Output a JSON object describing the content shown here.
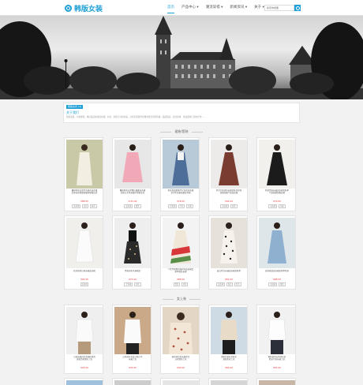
{
  "header": {
    "logo": "韩版女装",
    "nav": [
      "首页",
      "产品中心 ▾",
      "潮流穿搭 ▾",
      "新闻资讯 ▾",
      "关于 ▾"
    ],
    "search_placeholder": "搜索你想要"
  },
  "about": {
    "tag": "韩版女式 (4)",
    "title": "关于我们",
    "text": "韩版女装，时尚潮流，精心甄选各类连衣裙、衬衫、外套与针织单品，为您呈现简约优雅的韩式穿搭风格，品质保证，款式多样，欢迎选购与咨询合作……"
  },
  "sections": [
    {
      "title": "裙装/套装",
      "rows": [
        [
          {
            "desc": [
              "重磅新款法式复古碎花连衣裙",
              "女夏长款收腰显瘦茶歇裙法式"
            ],
            "price": "¥88.00",
            "tags": [
              "连衣裙",
              "法式",
              "碎花"
            ]
          },
          {
            "desc": [
              "重磅新款法式网纱蓬蓬连衣裙",
              "甜美公主风显瘦吊带裙法式"
            ],
            "price": "¥-25.00",
            "tags": [
              "连衣裙",
              "甜美"
            ]
          },
          {
            "desc": [
              "秋冬新款韩版牛仔背带连衣裙",
              "女学生长裙显瘦背带裙"
            ],
            "price": "¥76.00",
            "tags": [
              "背带裙",
              "牛仔",
              "长裙"
            ]
          },
          {
            "desc": [
              "复古红色印花长裙女秋冬新款",
              "高腰显瘦气质连衣裙"
            ],
            "price": "¥44.00",
            "tags": [
              "连衣裙",
              "印花"
            ]
          },
          {
            "desc": [
              "新款黑色长袖连衣裙女秋季",
              "气质收腰显瘦长裙"
            ],
            "price": "¥70.00",
            "tags": [
              "连衣裙",
              "长袖"
            ]
          }
        ],
        [
          {
            "desc": [
              "秋冬新款白色长袖连衣裙"
            ],
            "price": "¥91.00",
            "tags": [
              "连衣裙"
            ]
          },
          {
            "desc": [
              "黑色印花半身裙女"
            ],
            "price": "¥73.00",
            "tags": [
              "半身裙",
              "印花"
            ]
          },
          {
            "desc": [
              "个性不规则拼接印花连衣裙女",
              "夏季雪纺长裙"
            ],
            "price": "¥68.00",
            "tags": [
              "雪纺",
              "印花"
            ]
          },
          {
            "desc": [
              "波点复古长袖连衣裙女秋季"
            ],
            "price": "¥81.00",
            "tags": [
              "连衣裙",
              "波点",
              "复古"
            ]
          },
          {
            "desc": [
              "蓝色格纹连衣裙女夏季新款"
            ],
            "price": "¥68.00",
            "tags": [
              "连衣裙",
              "格纹"
            ]
          }
        ]
      ]
    },
    {
      "title": "女上装",
      "rows": [
        [
          {
            "desc": [
              "白色长袖衬衫女春秋新款",
              "宽松百搭雪纺上衣"
            ],
            "price": "¥24.00",
            "tags": [
              "衬衫",
              "白色"
            ]
          },
          {
            "desc": [
              "白色衬衫女设计感小众",
              "长袖上衣"
            ],
            "price": "¥33.00",
            "tags": [
              "衬衫",
              "设计感"
            ]
          },
          {
            "desc": [
              "碎花衬衫女长袖复古",
              "法式雪纺上衣"
            ],
            "price": "¥42.00",
            "tags": [
              "衬衫",
              "碎花",
              "复古"
            ]
          },
          {
            "desc": [
              "浅色针织衫女秋冬",
              "宽松毛衣上衣"
            ],
            "price": "¥69.00",
            "tags": [
              "针织衫",
              "毛衣"
            ]
          },
          {
            "desc": [
              "春秋新款白色衬衫女",
              "职业气质长袖上衣"
            ],
            "price": "¥63.00",
            "tags": [
              "衬衫",
              "职业"
            ]
          }
        ]
      ]
    }
  ]
}
